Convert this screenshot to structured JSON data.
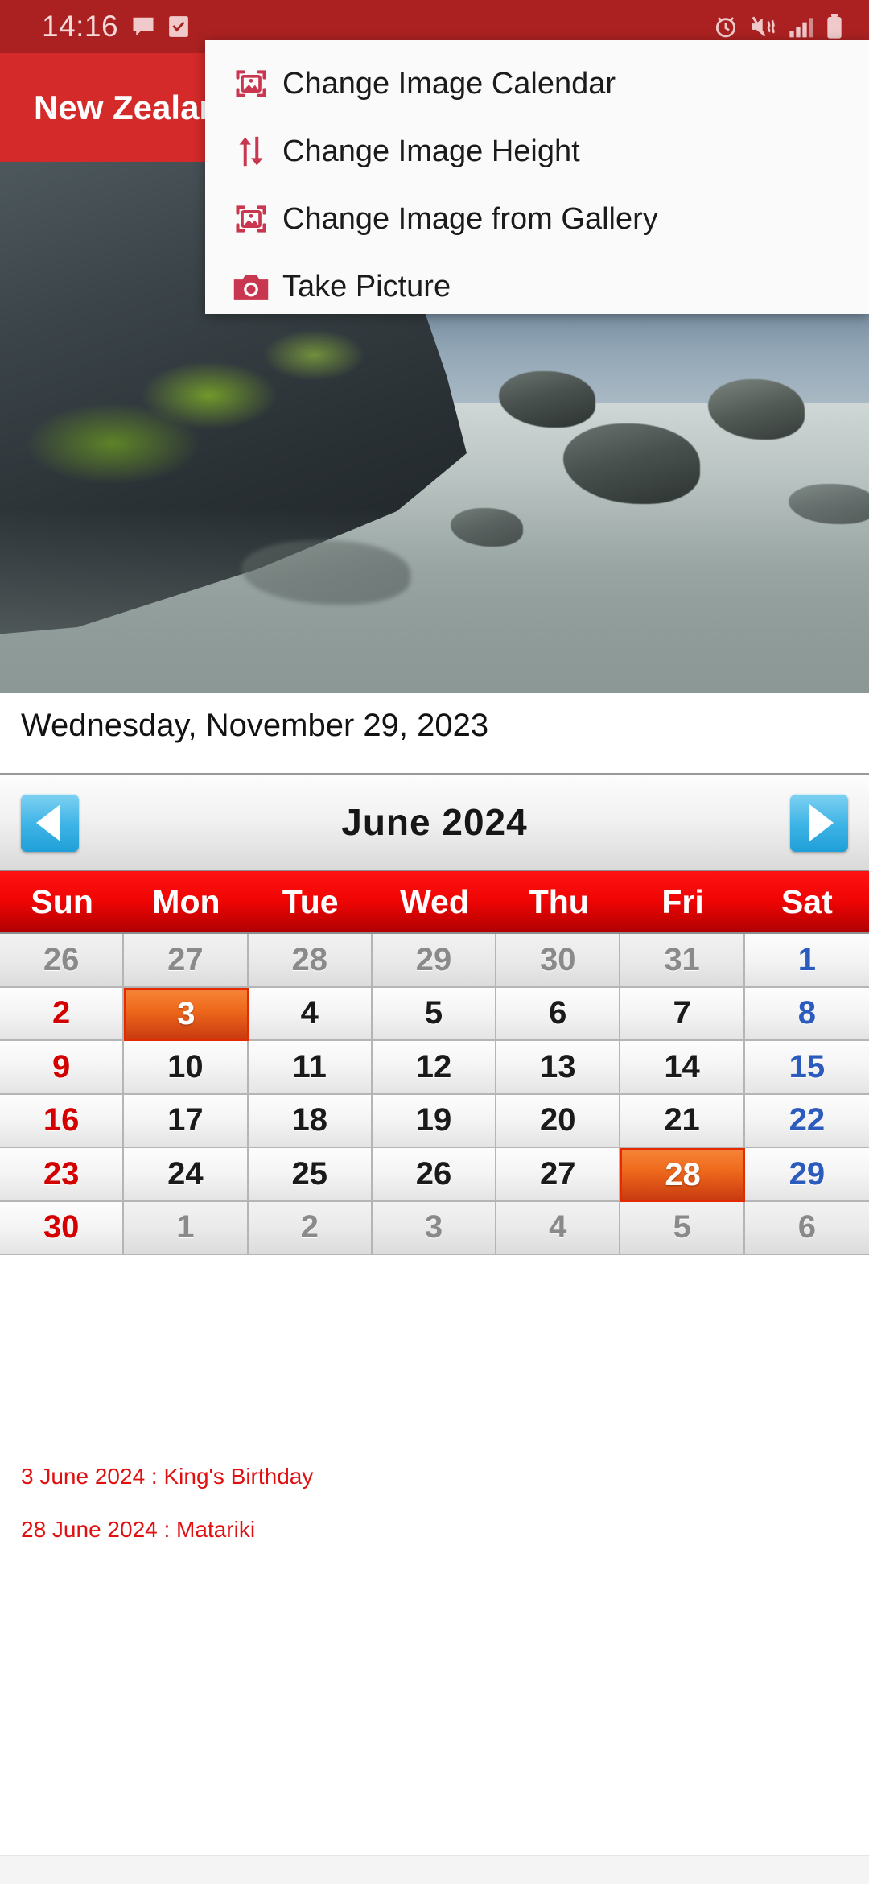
{
  "status_bar": {
    "clock": "14:16",
    "icons": [
      "message-icon",
      "checkbox-icon",
      "alarm-icon",
      "mute-vibrate-icon",
      "signal-icon",
      "battery-icon"
    ]
  },
  "app_bar": {
    "title": "New Zealand Calendar",
    "background_color": "#d42a2a"
  },
  "popup_menu": {
    "items": [
      {
        "label": "Change Image Calendar",
        "icon": "image-frame-icon"
      },
      {
        "label": "Change Image Height",
        "icon": "arrows-up-down-icon"
      },
      {
        "label": "Change Image from Gallery",
        "icon": "image-frame-icon"
      },
      {
        "label": "Take Picture",
        "icon": "camera-icon"
      }
    ],
    "accent_color": "#c9364f"
  },
  "hero": {
    "name": "calendar-header-photo"
  },
  "selected_date": "Wednesday, November 29, 2023",
  "calendar": {
    "prev_label": "◀",
    "next_label": "▶",
    "month": "June",
    "year": "2024",
    "title": "June  2024",
    "weekdays": [
      "Sun",
      "Mon",
      "Tue",
      "Wed",
      "Thu",
      "Fri",
      "Sat"
    ],
    "header_color": "#f00505",
    "selected_color": "#ef6a1c",
    "weeks": [
      [
        {
          "d": "26",
          "m": "prev"
        },
        {
          "d": "27",
          "m": "prev"
        },
        {
          "d": "28",
          "m": "prev"
        },
        {
          "d": "29",
          "m": "prev"
        },
        {
          "d": "30",
          "m": "prev"
        },
        {
          "d": "31",
          "m": "prev"
        },
        {
          "d": "1",
          "m": "cur",
          "w": "sat"
        }
      ],
      [
        {
          "d": "2",
          "m": "cur",
          "w": "sun"
        },
        {
          "d": "3",
          "m": "cur",
          "sel": true
        },
        {
          "d": "4",
          "m": "cur"
        },
        {
          "d": "5",
          "m": "cur"
        },
        {
          "d": "6",
          "m": "cur"
        },
        {
          "d": "7",
          "m": "cur"
        },
        {
          "d": "8",
          "m": "cur",
          "w": "sat"
        }
      ],
      [
        {
          "d": "9",
          "m": "cur",
          "w": "sun"
        },
        {
          "d": "10",
          "m": "cur"
        },
        {
          "d": "11",
          "m": "cur"
        },
        {
          "d": "12",
          "m": "cur"
        },
        {
          "d": "13",
          "m": "cur"
        },
        {
          "d": "14",
          "m": "cur"
        },
        {
          "d": "15",
          "m": "cur",
          "w": "sat"
        }
      ],
      [
        {
          "d": "16",
          "m": "cur",
          "w": "sun"
        },
        {
          "d": "17",
          "m": "cur"
        },
        {
          "d": "18",
          "m": "cur"
        },
        {
          "d": "19",
          "m": "cur"
        },
        {
          "d": "20",
          "m": "cur"
        },
        {
          "d": "21",
          "m": "cur"
        },
        {
          "d": "22",
          "m": "cur",
          "w": "sat"
        }
      ],
      [
        {
          "d": "23",
          "m": "cur",
          "w": "sun"
        },
        {
          "d": "24",
          "m": "cur"
        },
        {
          "d": "25",
          "m": "cur"
        },
        {
          "d": "26",
          "m": "cur"
        },
        {
          "d": "27",
          "m": "cur"
        },
        {
          "d": "28",
          "m": "cur",
          "sel": true
        },
        {
          "d": "29",
          "m": "cur",
          "w": "sat"
        }
      ],
      [
        {
          "d": "30",
          "m": "cur",
          "w": "sun"
        },
        {
          "d": "1",
          "m": "next"
        },
        {
          "d": "2",
          "m": "next"
        },
        {
          "d": "3",
          "m": "next"
        },
        {
          "d": "4",
          "m": "next"
        },
        {
          "d": "5",
          "m": "next"
        },
        {
          "d": "6",
          "m": "next"
        }
      ]
    ]
  },
  "holidays": [
    "3 June 2024 : King's Birthday",
    "28 June 2024 : Matariki"
  ]
}
